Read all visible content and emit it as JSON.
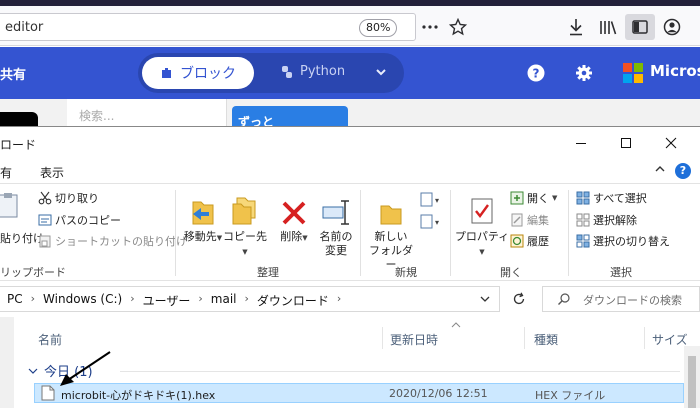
{
  "browser": {
    "url_text": "editor",
    "zoom": "80%"
  },
  "makecode": {
    "share_label": "共有",
    "blocks_label": "ブロック",
    "python_label": "Python",
    "brand": "Microsoft",
    "search_placeholder": "検索...",
    "category_label": "ずっと"
  },
  "explorer": {
    "title": "ロード",
    "menu": [
      "有",
      "表示"
    ],
    "clipboard": {
      "cut": "切り取り",
      "copy_path": "パスのコピー",
      "paste_shortcut": "ショートカットの貼り付け",
      "paste_partial": "貼り付け",
      "group_label": "リップボード"
    },
    "organize": {
      "move_to": "移動先",
      "copy_to": "コピー先",
      "delete": "削除",
      "rename_line1": "名前の",
      "rename_line2": "変更",
      "group_label": "整理"
    },
    "new": {
      "new_folder_line1": "新しい",
      "new_folder_line2": "フォルダー",
      "group_label": "新規"
    },
    "open": {
      "properties": "プロパティ",
      "open": "開く",
      "edit": "編集",
      "history": "履歴",
      "group_label": "開く"
    },
    "select": {
      "select_all": "すべて選択",
      "select_none": "選択解除",
      "invert": "選択の切り替え",
      "group_label": "選択"
    },
    "address": {
      "crumbs": [
        "PC",
        "Windows (C:)",
        "ユーザー",
        "mail",
        "ダウンロード"
      ],
      "search_placeholder": "ダウンロードの検索"
    },
    "columns": {
      "name": "名前",
      "modified": "更新日時",
      "type": "種類",
      "size": "サイズ"
    },
    "group_today": "今日 (1)",
    "file": {
      "name": "microbit-心がドキドキ(1).hex",
      "modified": "2020/12/06 12:51",
      "type": "HEX ファイル"
    }
  }
}
